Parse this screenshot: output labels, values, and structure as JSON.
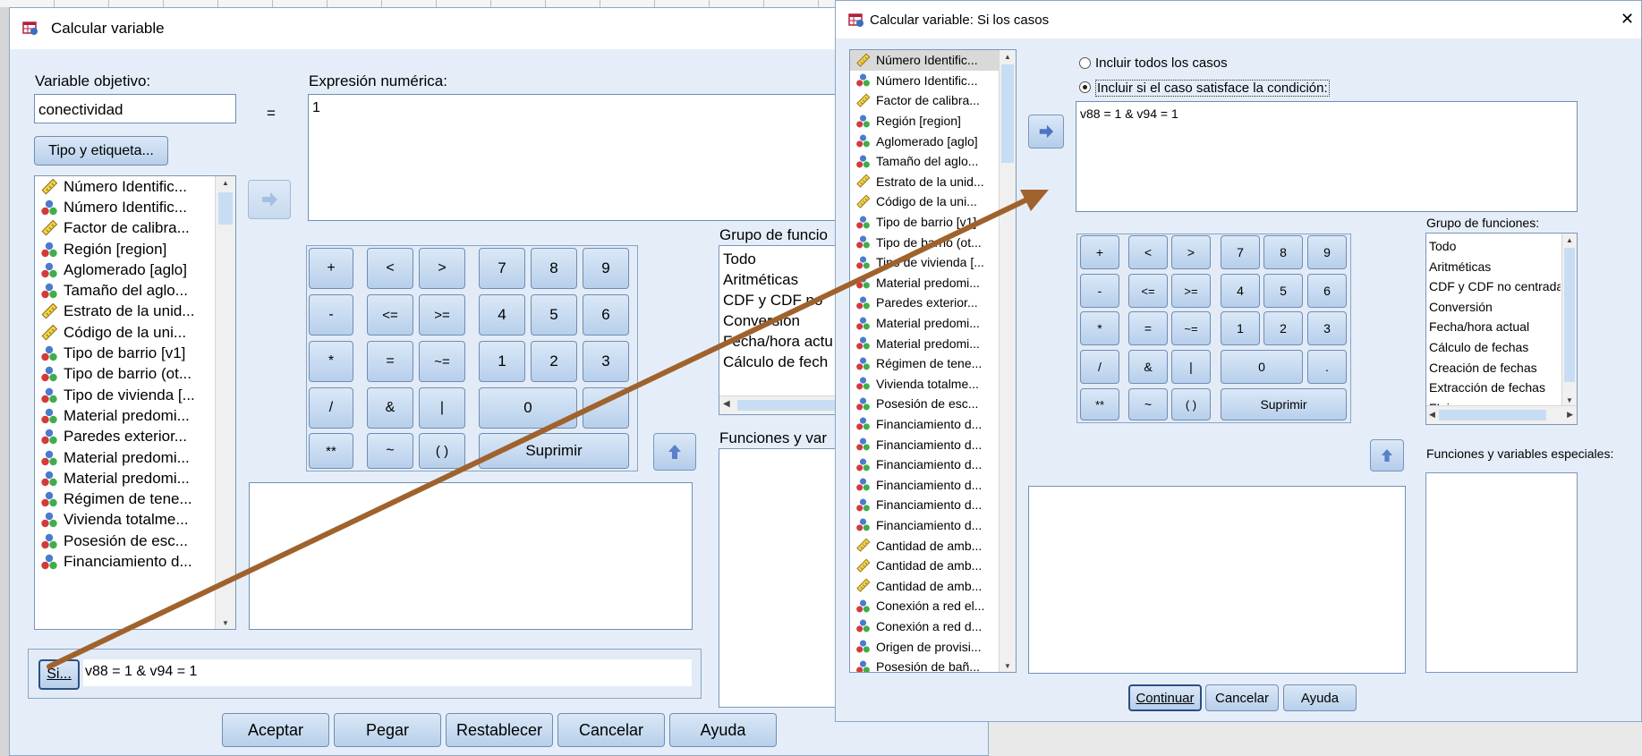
{
  "colors": {
    "dialog_bg": "#e5eef8",
    "arrow": "#a0622d",
    "accent_button": "#b7cfeb"
  },
  "back_dialog": {
    "title": "Calcular variable",
    "target_label": "Variable objetivo:",
    "target_value": "conectividad",
    "equals": "=",
    "expr_label": "Expresión numérica:",
    "expr_value": "1",
    "type_button": "Tipo y etiqueta...",
    "variables": [
      {
        "label": "Número Identific...",
        "type": "scale"
      },
      {
        "label": "Número Identific...",
        "type": "nominal"
      },
      {
        "label": "Factor de calibra...",
        "type": "scale"
      },
      {
        "label": "Región [region]",
        "type": "nominal"
      },
      {
        "label": "Aglomerado [aglo]",
        "type": "nominal"
      },
      {
        "label": "Tamaño del aglo...",
        "type": "nominal"
      },
      {
        "label": "Estrato de la unid...",
        "type": "scale"
      },
      {
        "label": "Código de la uni...",
        "type": "scale"
      },
      {
        "label": "Tipo de barrio [v1]",
        "type": "nominal"
      },
      {
        "label": "Tipo de barrio (ot...",
        "type": "nominal"
      },
      {
        "label": "Tipo de vivienda [...",
        "type": "nominal"
      },
      {
        "label": "Material predomi...",
        "type": "nominal"
      },
      {
        "label": "Paredes exterior...",
        "type": "nominal"
      },
      {
        "label": "Material predomi...",
        "type": "nominal"
      },
      {
        "label": "Material predomi...",
        "type": "nominal"
      },
      {
        "label": "Régimen de tene...",
        "type": "nominal"
      },
      {
        "label": "Vivienda totalme...",
        "type": "nominal"
      },
      {
        "label": "Posesión de esc...",
        "type": "nominal"
      },
      {
        "label": "Financiamiento d...",
        "type": "nominal"
      }
    ],
    "keypad": {
      "plus": "+",
      "lt": "<",
      "gt": ">",
      "k7": "7",
      "k8": "8",
      "k9": "9",
      "minus": "-",
      "le": "<=",
      "ge": ">=",
      "k4": "4",
      "k5": "5",
      "k6": "6",
      "mul": "*",
      "eq": "=",
      "ne": "~=",
      "k1": "1",
      "k2": "2",
      "k3": "3",
      "div": "/",
      "and": "&",
      "or": "|",
      "k0": "0",
      "pow": "**",
      "not": "~",
      "paren": "( )",
      "delete": "Suprimir"
    },
    "func_group_label": "Grupo de funcio",
    "func_groups": [
      "Todo",
      "Aritméticas",
      "CDF y CDF no",
      "Conversión",
      "Fecha/hora actu",
      "Cálculo de fech"
    ],
    "func_vars_label": "Funciones y var",
    "si_button": "Si...",
    "condition": "v88 = 1 & v94 = 1",
    "buttons": {
      "accept": "Aceptar",
      "paste": "Pegar",
      "reset": "Restablecer",
      "cancel": "Cancelar",
      "help": "Ayuda"
    }
  },
  "front_dialog": {
    "title": "Calcular variable: Si los casos",
    "close": "✕",
    "radio_all": "Incluir todos los casos",
    "radio_if": "Incluir si el caso satisface la condición:",
    "condition": "v88 = 1 & v94 = 1",
    "variables": [
      {
        "label": "Número Identific...",
        "type": "scale"
      },
      {
        "label": "Número Identific...",
        "type": "nominal"
      },
      {
        "label": "Factor de calibra...",
        "type": "scale"
      },
      {
        "label": "Región [region]",
        "type": "nominal"
      },
      {
        "label": "Aglomerado [aglo]",
        "type": "nominal"
      },
      {
        "label": "Tamaño del aglo...",
        "type": "nominal"
      },
      {
        "label": "Estrato de la unid...",
        "type": "scale"
      },
      {
        "label": "Código de la uni...",
        "type": "scale"
      },
      {
        "label": "Tipo de barrio [v1]",
        "type": "nominal"
      },
      {
        "label": "Tipo de barrio (ot...",
        "type": "nominal"
      },
      {
        "label": "Tipo de vivienda [...",
        "type": "nominal"
      },
      {
        "label": "Material predomi...",
        "type": "nominal"
      },
      {
        "label": "Paredes exterior...",
        "type": "nominal"
      },
      {
        "label": "Material predomi...",
        "type": "nominal"
      },
      {
        "label": "Material predomi...",
        "type": "nominal"
      },
      {
        "label": "Régimen de tene...",
        "type": "nominal"
      },
      {
        "label": "Vivienda totalme...",
        "type": "nominal"
      },
      {
        "label": "Posesión de esc...",
        "type": "nominal"
      },
      {
        "label": "Financiamiento d...",
        "type": "nominal"
      },
      {
        "label": "Financiamiento d...",
        "type": "nominal"
      },
      {
        "label": "Financiamiento d...",
        "type": "nominal"
      },
      {
        "label": "Financiamiento d...",
        "type": "nominal"
      },
      {
        "label": "Financiamiento d...",
        "type": "nominal"
      },
      {
        "label": "Financiamiento d...",
        "type": "nominal"
      },
      {
        "label": "Cantidad de amb...",
        "type": "scale"
      },
      {
        "label": "Cantidad de amb...",
        "type": "scale"
      },
      {
        "label": "Cantidad de amb...",
        "type": "scale"
      },
      {
        "label": "Conexión a red el...",
        "type": "nominal"
      },
      {
        "label": "Conexión a red d...",
        "type": "nominal"
      },
      {
        "label": "Origen de provisi...",
        "type": "nominal"
      },
      {
        "label": "Posesión de bañ...",
        "type": "nominal"
      }
    ],
    "keypad": {
      "plus": "+",
      "lt": "<",
      "gt": ">",
      "k7": "7",
      "k8": "8",
      "k9": "9",
      "minus": "-",
      "le": "<=",
      "ge": ">=",
      "k4": "4",
      "k5": "5",
      "k6": "6",
      "mul": "*",
      "eq": "=",
      "ne": "~=",
      "k1": "1",
      "k2": "2",
      "k3": "3",
      "div": "/",
      "and": "&",
      "or": "|",
      "k0": "0",
      "dot": ".",
      "pow": "**",
      "not": "~",
      "paren": "( )",
      "delete": "Suprimir"
    },
    "func_group_label": "Grupo de funciones:",
    "func_groups": [
      "Todo",
      "Aritméticas",
      "CDF y CDF no centrada",
      "Conversión",
      "Fecha/hora actual",
      "Cálculo de fechas",
      "Creación de fechas",
      "Extracción de fechas",
      "FL inversas"
    ],
    "func_vars_label": "Funciones y variables especiales:",
    "buttons": {
      "continue": "Continuar",
      "cancel": "Cancelar",
      "help": "Ayuda"
    }
  }
}
